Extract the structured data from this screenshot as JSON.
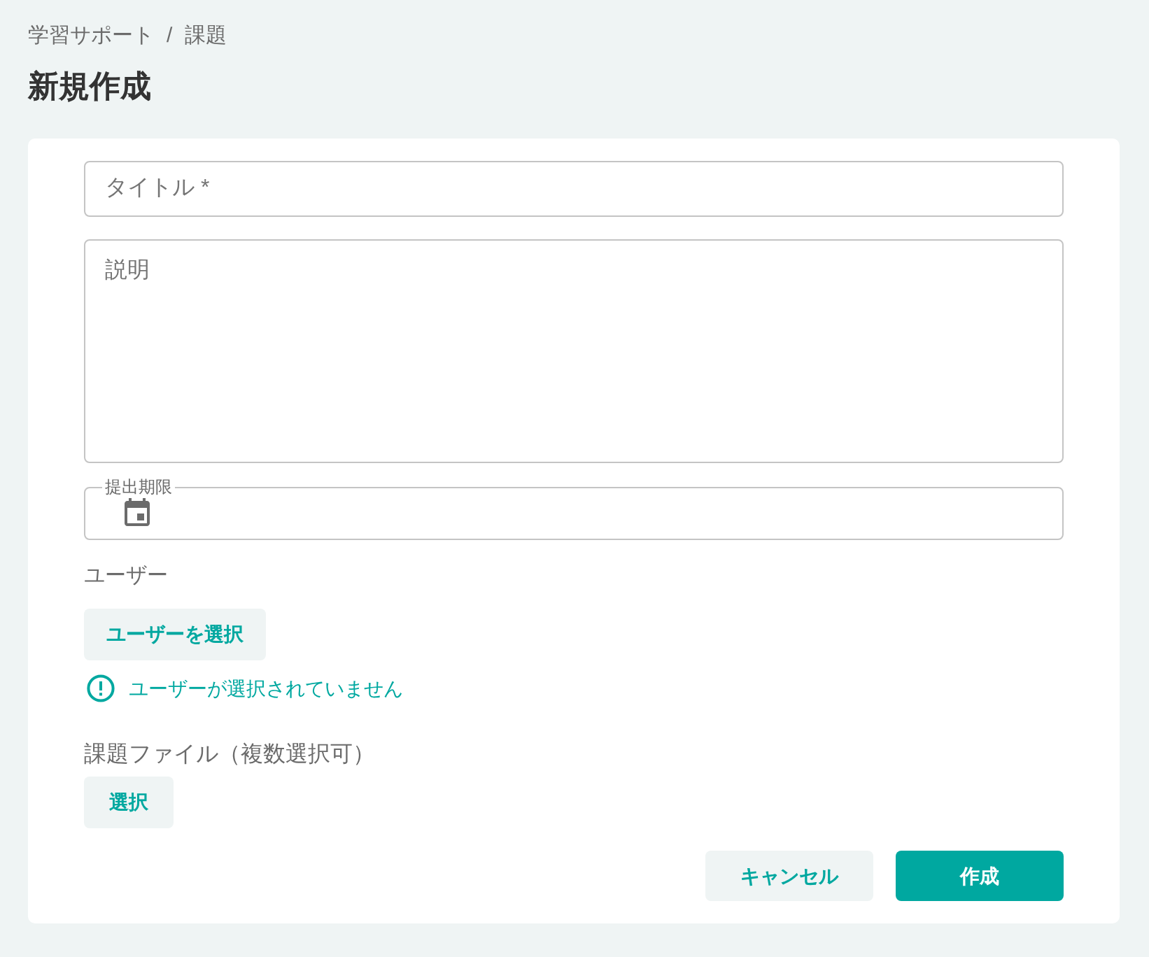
{
  "breadcrumb": {
    "items": [
      "学習サポート",
      "課題"
    ],
    "separator": "/"
  },
  "page_title": "新規作成",
  "form": {
    "fields": [
      {
        "kind": "text",
        "placeholder": "タイトル *"
      },
      {
        "kind": "textarea",
        "placeholder": "説明"
      },
      {
        "kind": "date",
        "label": "提出期限"
      }
    ],
    "users": {
      "label": "ユーザー",
      "button": "ユーザーを選択",
      "warning": "ユーザーが選択されていません"
    },
    "files": {
      "label": "課題ファイル（複数選択可）",
      "button": "選択"
    },
    "actions": [
      {
        "kind": "secondary",
        "label": "キャンセル"
      },
      {
        "kind": "primary",
        "label": "作成"
      }
    ]
  }
}
